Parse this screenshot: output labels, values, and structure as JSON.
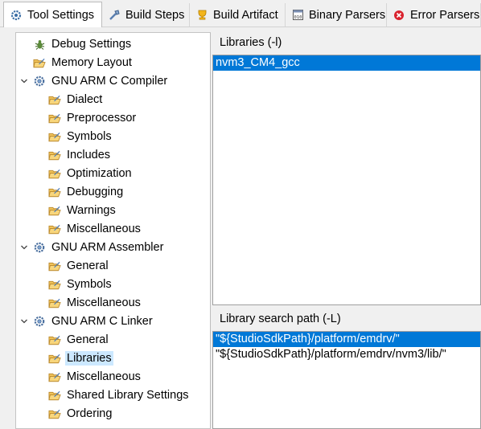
{
  "tabs": [
    {
      "label": "Tool Settings",
      "icon": "tool-settings-icon",
      "active": true
    },
    {
      "label": "Build Steps",
      "icon": "build-steps-icon",
      "active": false
    },
    {
      "label": "Build Artifact",
      "icon": "build-artifact-icon",
      "active": false
    },
    {
      "label": "Binary Parsers",
      "icon": "binary-parsers-icon",
      "active": false
    },
    {
      "label": "Error Parsers",
      "icon": "error-parsers-icon",
      "active": false
    }
  ],
  "tree": [
    {
      "label": "Debug Settings",
      "icon": "debug-settings-icon",
      "level": 0,
      "expandable": false,
      "selected": false
    },
    {
      "label": "Memory Layout",
      "icon": "folder-icon",
      "level": 0,
      "expandable": false,
      "selected": false
    },
    {
      "label": "GNU ARM C Compiler",
      "icon": "tool-gear-icon",
      "level": 0,
      "expandable": true,
      "expanded": true,
      "selected": false
    },
    {
      "label": "Dialect",
      "icon": "folder-icon",
      "level": 1,
      "selected": false
    },
    {
      "label": "Preprocessor",
      "icon": "folder-icon",
      "level": 1,
      "selected": false
    },
    {
      "label": "Symbols",
      "icon": "folder-icon",
      "level": 1,
      "selected": false
    },
    {
      "label": "Includes",
      "icon": "folder-icon",
      "level": 1,
      "selected": false
    },
    {
      "label": "Optimization",
      "icon": "folder-icon",
      "level": 1,
      "selected": false
    },
    {
      "label": "Debugging",
      "icon": "folder-icon",
      "level": 1,
      "selected": false
    },
    {
      "label": "Warnings",
      "icon": "folder-icon",
      "level": 1,
      "selected": false
    },
    {
      "label": "Miscellaneous",
      "icon": "folder-icon",
      "level": 1,
      "selected": false
    },
    {
      "label": "GNU ARM Assembler",
      "icon": "tool-gear-icon",
      "level": 0,
      "expandable": true,
      "expanded": true,
      "selected": false
    },
    {
      "label": "General",
      "icon": "folder-icon",
      "level": 1,
      "selected": false
    },
    {
      "label": "Symbols",
      "icon": "folder-icon",
      "level": 1,
      "selected": false
    },
    {
      "label": "Miscellaneous",
      "icon": "folder-icon",
      "level": 1,
      "selected": false
    },
    {
      "label": "GNU ARM C Linker",
      "icon": "tool-gear-icon",
      "level": 0,
      "expandable": true,
      "expanded": true,
      "selected": false
    },
    {
      "label": "General",
      "icon": "folder-icon",
      "level": 1,
      "selected": false
    },
    {
      "label": "Libraries",
      "icon": "folder-icon",
      "level": 1,
      "selected": true
    },
    {
      "label": "Miscellaneous",
      "icon": "folder-icon",
      "level": 1,
      "selected": false
    },
    {
      "label": "Shared Library Settings",
      "icon": "folder-icon",
      "level": 1,
      "selected": false
    },
    {
      "label": "Ordering",
      "icon": "folder-icon",
      "level": 1,
      "selected": false
    }
  ],
  "libraries": {
    "header": "Libraries (-l)",
    "items": [
      {
        "value": "nvm3_CM4_gcc",
        "selected": true
      }
    ]
  },
  "search_path": {
    "header": "Library search path (-L)",
    "items": [
      {
        "value": "\"${StudioSdkPath}/platform/emdrv/\"",
        "selected": true
      },
      {
        "value": "\"${StudioSdkPath}/platform/emdrv/nvm3/lib/\"",
        "selected": false
      }
    ]
  },
  "colors": {
    "selection": "#0078d7",
    "tree_selection": "#cce8ff",
    "folder": "#f2c14e",
    "error": "#d9232e"
  }
}
